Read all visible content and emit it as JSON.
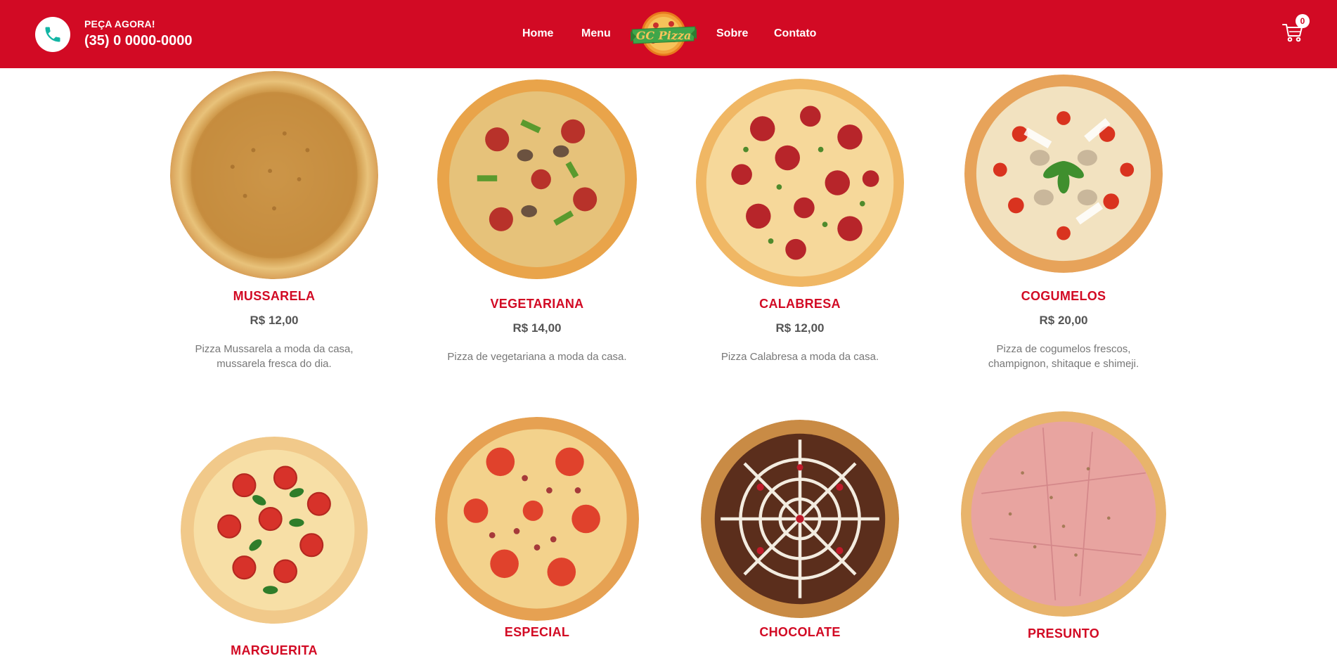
{
  "header": {
    "order_label": "PEÇA AGORA!",
    "order_phone": "(35) 0 0000-0000",
    "nav": [
      {
        "label": "Home"
      },
      {
        "label": "Menu"
      },
      {
        "label": "Sobre"
      },
      {
        "label": "Contato"
      }
    ],
    "logo_text": "GC Pizza",
    "cart_count": "0",
    "colors": {
      "brand": "#d20a24",
      "accent_teal": "#12b5a4"
    }
  },
  "products": [
    {
      "name": "MUSSARELA",
      "price": "R$ 12,00",
      "desc": "Pizza Mussarela a moda da casa, mussarela fresca do dia.",
      "image": "cheese-pizza"
    },
    {
      "name": "VEGETARIANA",
      "price": "R$ 14,00",
      "desc": "Pizza de vegetariana a moda da casa.",
      "image": "vegetarian-pizza"
    },
    {
      "name": "CALABRESA",
      "price": "R$ 12,00",
      "desc": "Pizza Calabresa a moda da casa.",
      "image": "calabresa-pizza"
    },
    {
      "name": "COGUMELOS",
      "price": "R$ 20,00",
      "desc": "Pizza de cogumelos frescos, champignon, shitaque e shimeji.",
      "image": "mushroom-pizza"
    },
    {
      "name": "MARGUERITA",
      "price": "",
      "desc": "",
      "image": "margherita-pizza"
    },
    {
      "name": "ESPECIAL",
      "price": "",
      "desc": "",
      "image": "special-pizza"
    },
    {
      "name": "CHOCOLATE",
      "price": "",
      "desc": "",
      "image": "chocolate-pizza"
    },
    {
      "name": "PRESUNTO",
      "price": "",
      "desc": "",
      "image": "ham-pizza"
    }
  ]
}
